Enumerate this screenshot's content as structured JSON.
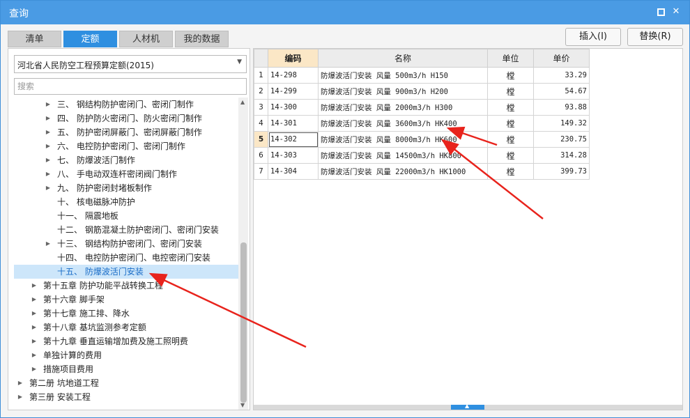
{
  "window": {
    "title": "查询"
  },
  "tabs": [
    {
      "label": "清单",
      "active": false
    },
    {
      "label": "定额",
      "active": true
    },
    {
      "label": "人材机",
      "active": false
    },
    {
      "label": "我的数据",
      "active": false
    }
  ],
  "actions": {
    "insert_label": "插入(I)",
    "replace_label": "替换(R)"
  },
  "quota_library": {
    "selected": "河北省人民防空工程预算定额(2015)"
  },
  "search": {
    "placeholder": "搜索"
  },
  "tree": [
    {
      "label": "三、 钢结构防护密闭门、密闭门制作",
      "expandable": true
    },
    {
      "label": "四、 防护防火密闭门、防火密闭门制作",
      "expandable": true
    },
    {
      "label": "五、 防护密闭屏蔽门、密闭屏蔽门制作",
      "expandable": true
    },
    {
      "label": "六、 电控防护密闭门、密闭门制作",
      "expandable": true
    },
    {
      "label": "七、 防爆波活门制作",
      "expandable": true
    },
    {
      "label": "八、 手电动双连杆密闭阀门制作",
      "expandable": true
    },
    {
      "label": "九、 防护密闭封堵板制作",
      "expandable": true
    },
    {
      "label": "十、 核电磁脉冲防护",
      "expandable": false
    },
    {
      "label": "十一、 隔震地板",
      "expandable": false
    },
    {
      "label": "十二、 钢筋混凝土防护密闭门、密闭门安装",
      "expandable": false
    },
    {
      "label": "十三、 钢结构防护密闭门、密闭门安装",
      "expandable": true
    },
    {
      "label": "十四、 电控防护密闭门、电控密闭门安装",
      "expandable": false
    },
    {
      "label": "十五、 防爆波活门安装",
      "expandable": false,
      "selected": true
    },
    {
      "label": "第十五章 防护功能平战转换工程",
      "expandable": true
    },
    {
      "label": "第十六章 脚手架",
      "expandable": true
    },
    {
      "label": "第十七章 施工排、降水",
      "expandable": true
    },
    {
      "label": "第十八章 基坑监测参考定额",
      "expandable": true
    },
    {
      "label": "第十九章 垂直运输增加费及施工照明费",
      "expandable": true
    },
    {
      "label": "单独计算的费用",
      "expandable": true
    },
    {
      "label": "措施项目费用",
      "expandable": true
    },
    {
      "label": "第二册 坑地道工程",
      "expandable": true
    },
    {
      "label": "第三册 安装工程",
      "expandable": true
    }
  ],
  "grid": {
    "columns": {
      "code": "编码",
      "name": "名称",
      "unit": "单位",
      "price": "单价"
    },
    "rows": [
      {
        "no": "1",
        "code": "14-298",
        "name": "防爆波活门安装 风量 500m3/h H150",
        "unit": "樘",
        "price": "33.29"
      },
      {
        "no": "2",
        "code": "14-299",
        "name": "防爆波活门安装 风量 900m3/h H200",
        "unit": "樘",
        "price": "54.67"
      },
      {
        "no": "3",
        "code": "14-300",
        "name": "防爆波活门安装 风量 2000m3/h H300",
        "unit": "樘",
        "price": "93.88"
      },
      {
        "no": "4",
        "code": "14-301",
        "name": "防爆波活门安装 风量 3600m3/h HK400",
        "unit": "樘",
        "price": "149.32"
      },
      {
        "no": "5",
        "code": "14-302",
        "name": "防爆波活门安装 风量 8000m3/h HK600",
        "unit": "樘",
        "price": "230.75"
      },
      {
        "no": "6",
        "code": "14-303",
        "name": "防爆波活门安装 风量 14500m3/h HK800",
        "unit": "樘",
        "price": "314.28"
      },
      {
        "no": "7",
        "code": "14-304",
        "name": "防爆波活门安装 风量 22000m3/h HK1000",
        "unit": "樘",
        "price": "399.73"
      }
    ],
    "current_row": "5"
  },
  "colors": {
    "titlebar": "#4a9be4",
    "active_tab": "#2f8fe0",
    "selection": "#cde6fa",
    "annotation_arrow": "#e8231c"
  }
}
